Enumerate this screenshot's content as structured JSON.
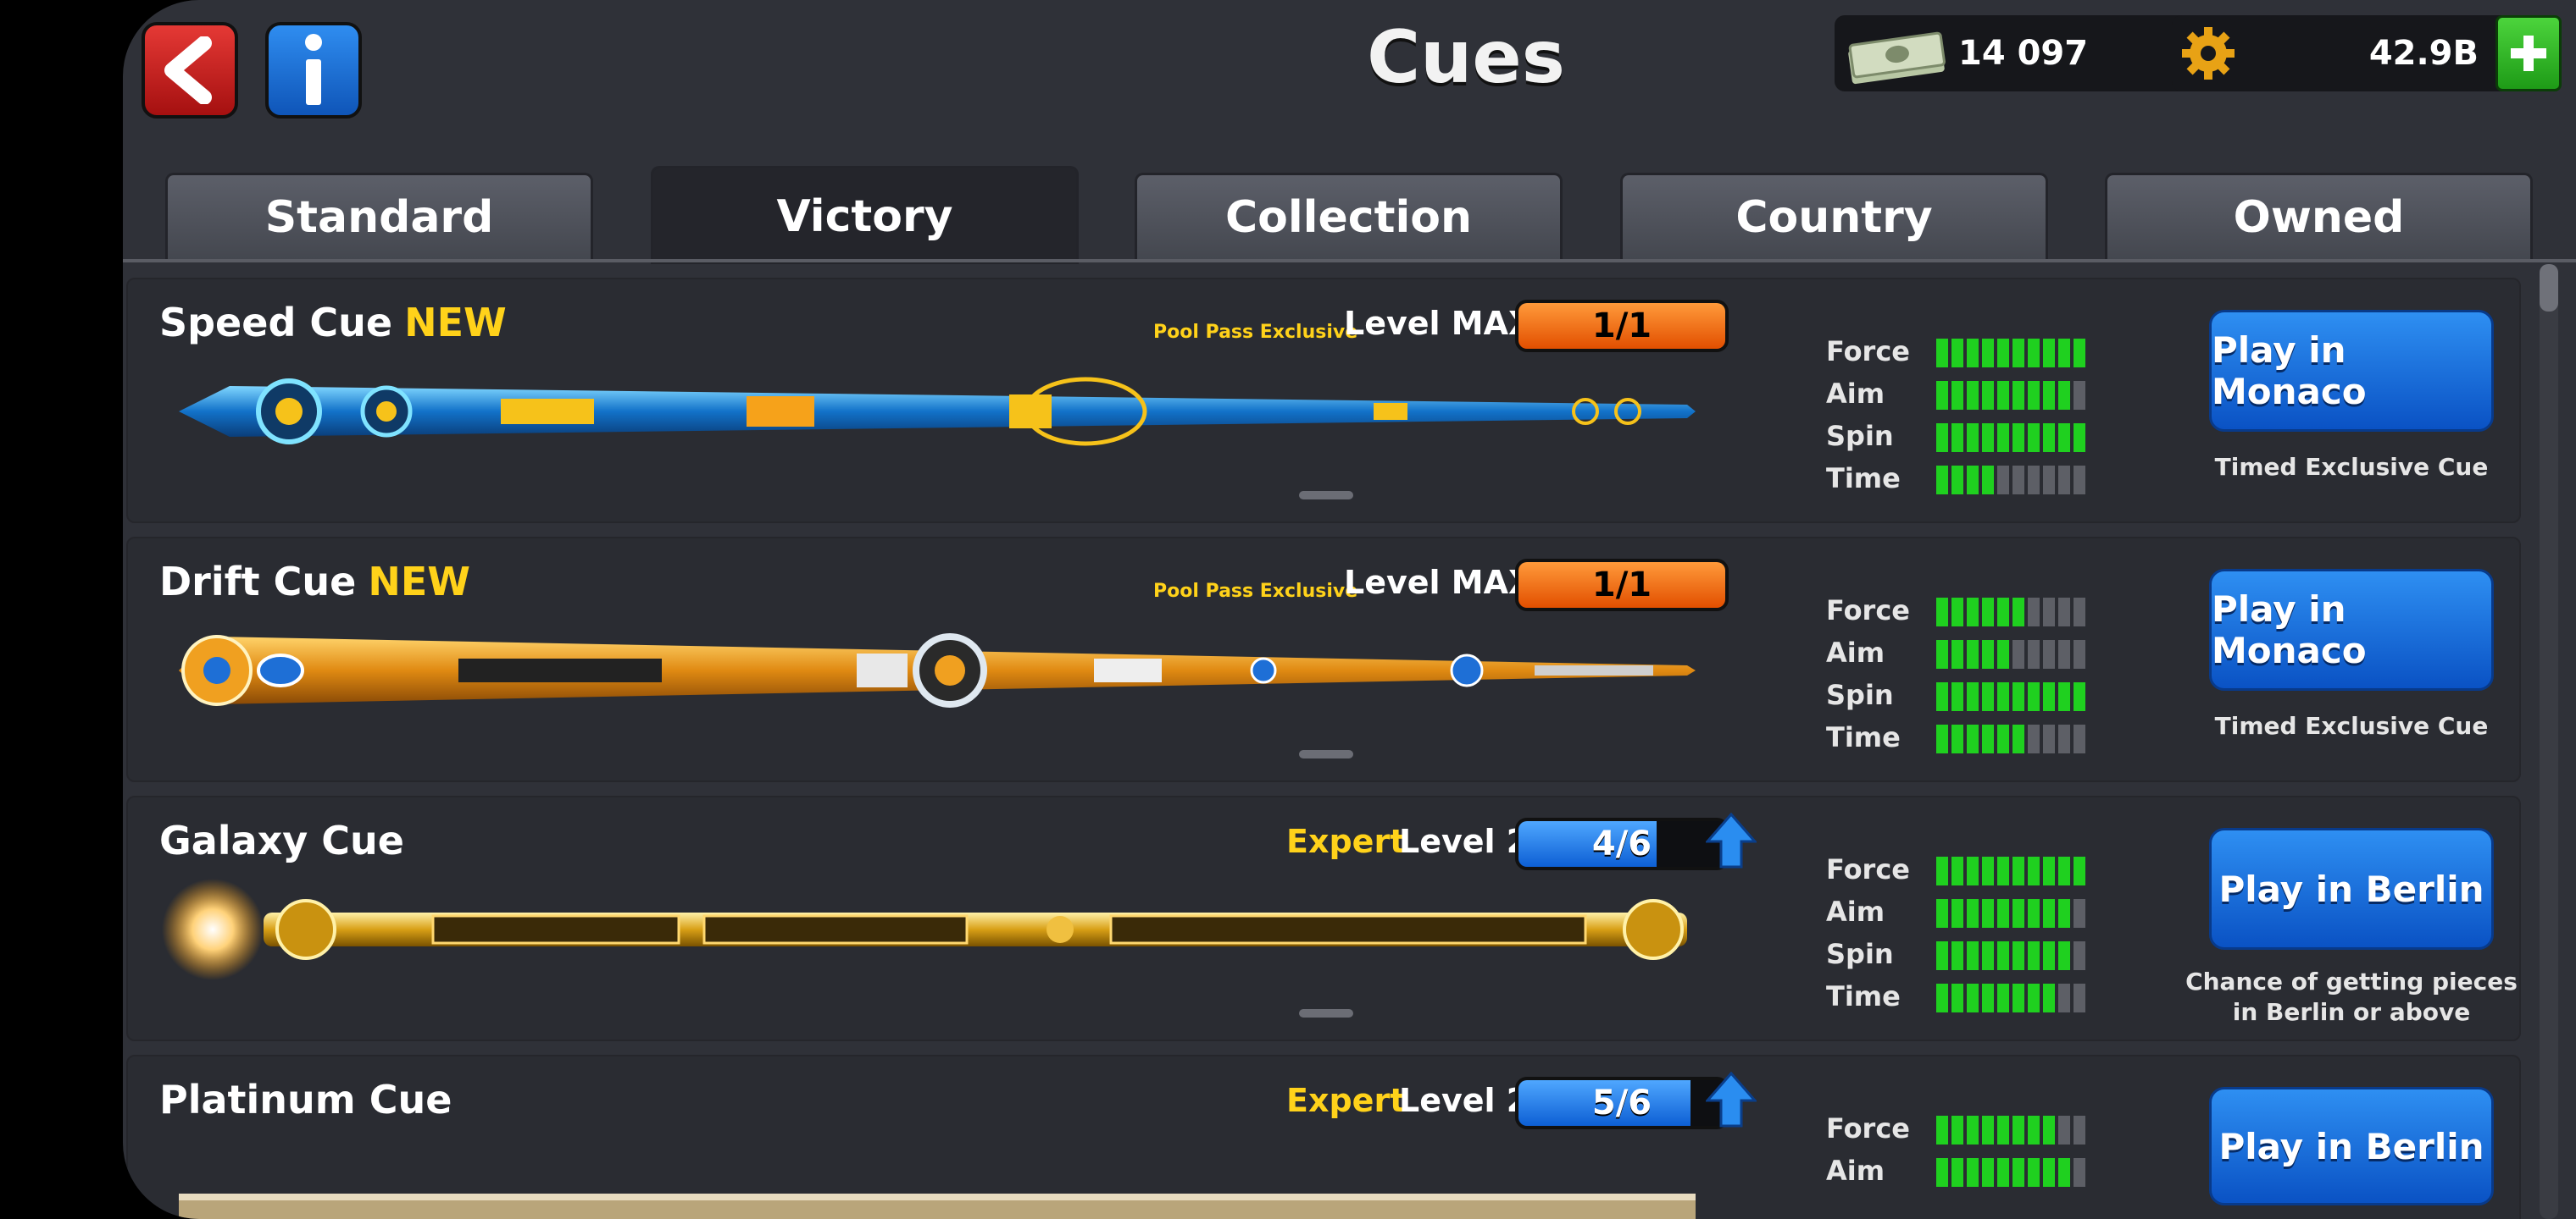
{
  "header": {
    "title": "Cues",
    "back_icon": "back-arrow-icon",
    "info_icon": "info-icon",
    "cash": "14 097",
    "coins": "42.9B"
  },
  "tabs": [
    {
      "label": "Standard",
      "active": false
    },
    {
      "label": "Victory",
      "active": true
    },
    {
      "label": "Collection",
      "active": false
    },
    {
      "label": "Country",
      "active": false
    },
    {
      "label": "Owned",
      "active": false
    }
  ],
  "stat_labels": {
    "force": "Force",
    "aim": "Aim",
    "spin": "Spin",
    "time": "Time"
  },
  "cues": [
    {
      "name": "Speed Cue",
      "new_tag": "NEW",
      "tag": "Pool Pass Exclusive",
      "level": "Level MAX",
      "progress": "1/1",
      "stats": {
        "force": 10,
        "aim": 9,
        "spin": 10,
        "time": 4
      },
      "button": "Play in Monaco",
      "note": "Timed Exclusive Cue"
    },
    {
      "name": "Drift Cue",
      "new_tag": "NEW",
      "tag": "Pool Pass Exclusive",
      "level": "Level MAX",
      "progress": "1/1",
      "stats": {
        "force": 6,
        "aim": 5,
        "spin": 10,
        "time": 6
      },
      "button": "Play in Monaco",
      "note": "Timed Exclusive Cue"
    },
    {
      "name": "Galaxy Cue",
      "tag": "Expert",
      "level": "Level 2",
      "progress": "4/6",
      "progress_fraction": 0.667,
      "stats": {
        "force": 10,
        "aim": 9,
        "spin": 9,
        "time": 8
      },
      "button": "Play in Berlin",
      "note": "Chance of getting pieces in Berlin or above"
    },
    {
      "name": "Platinum Cue",
      "tag": "Expert",
      "level": "Level 2",
      "progress": "5/6",
      "progress_fraction": 0.833,
      "stats": {
        "force": 8,
        "aim": 9
      },
      "button": "Play in Berlin"
    }
  ]
}
